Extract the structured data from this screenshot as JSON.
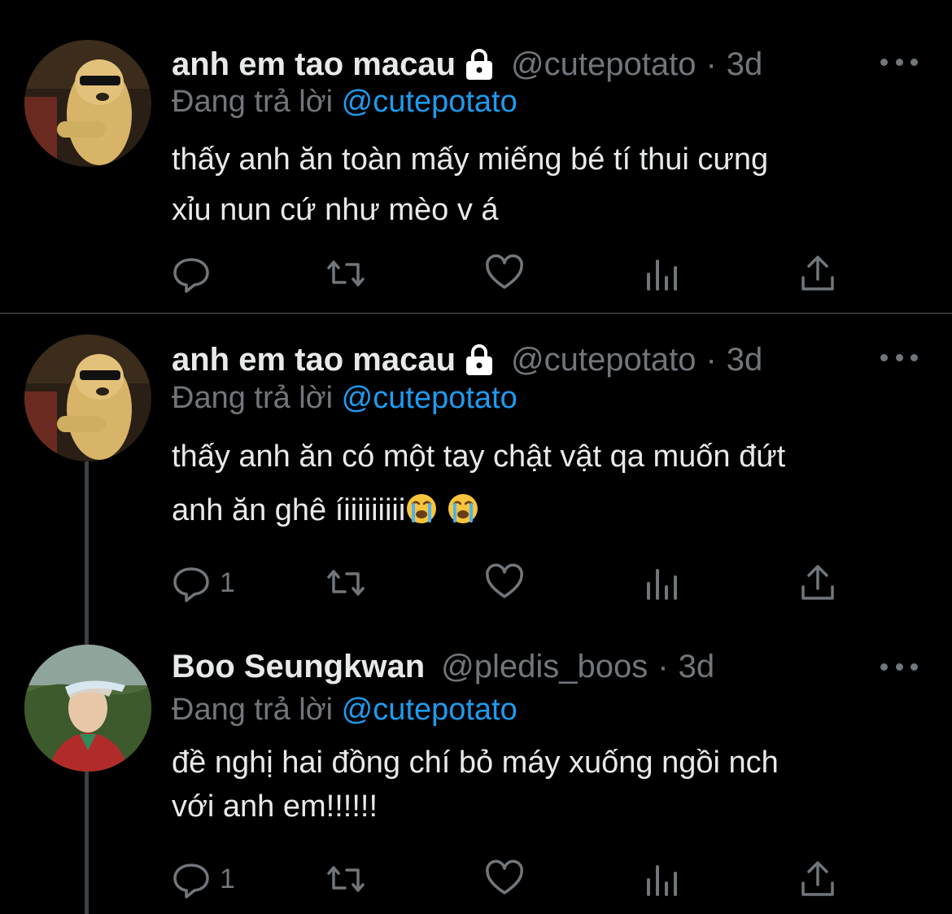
{
  "tweets": [
    {
      "name": "anh em tao macau",
      "handle": "@cutepotato",
      "dot": "·",
      "time": "3d",
      "reply_prefix": "Đang trả lời",
      "reply_mention": "@cutepotato",
      "text_lines": [
        "thấy anh ăn toàn mấy miếng bé tí thui cưng",
        "xỉu nun cứ như mèo v á"
      ],
      "reply_count": "",
      "locked": true
    },
    {
      "name": "anh em tao macau",
      "handle": "@cutepotato",
      "dot": "·",
      "time": "3d",
      "reply_prefix": "Đang trả lời",
      "reply_mention": "@cutepotato",
      "text_lines": [
        "thấy anh ăn có một tay chật vật qa muốn đứt",
        "anh ăn ghê íiiiiiiiii"
      ],
      "reply_count": "1",
      "locked": true
    },
    {
      "name": "Boo Seungkwan",
      "handle": "@pledis_boos",
      "dot": "·",
      "time": "3d",
      "reply_prefix": "Đang trả lời",
      "reply_mention": "@cutepotato",
      "text_lines": [
        "đề nghị hai đồng chí bỏ máy xuống ngồi nch",
        "với anh em!!!!!!"
      ],
      "reply_count": "1",
      "locked": false
    }
  ],
  "icons": {
    "reply": "reply-icon",
    "retweet": "retweet-icon",
    "like": "heart-icon",
    "views": "analytics-icon",
    "share": "share-icon",
    "more": "more-icon",
    "lock": "lock-icon",
    "emoji": "loudly-crying-face-emoji"
  },
  "colors": {
    "background": "#000000",
    "text": "#e7e9ea",
    "muted": "#71767b",
    "link": "#1d9bf0",
    "divider": "#2f3336"
  }
}
